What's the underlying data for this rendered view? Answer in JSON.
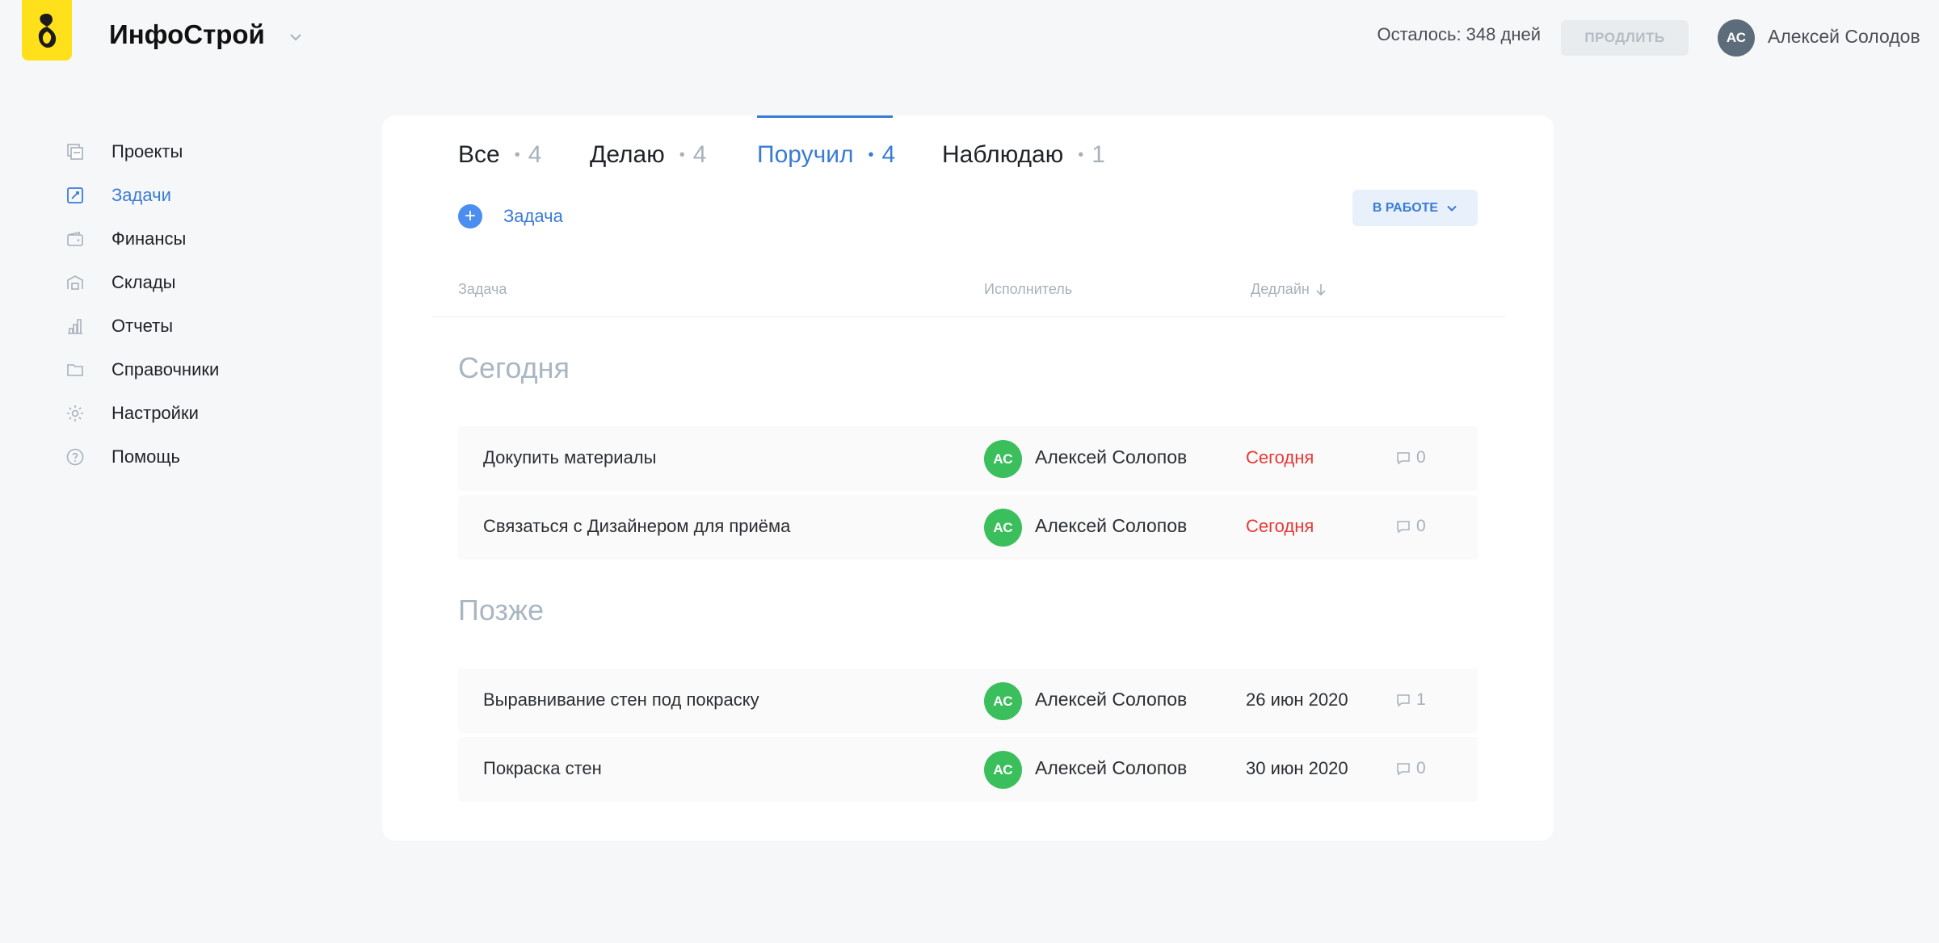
{
  "header": {
    "org_name": "ИнфоСтрой",
    "days_left": "Осталось: 348 дней",
    "extend_label": "ПРОДЛИТЬ",
    "user_initials": "АС",
    "user_name": "Алексей Солодов"
  },
  "sidebar": {
    "items": [
      {
        "label": "Проекты",
        "icon": "projects-icon"
      },
      {
        "label": "Задачи",
        "icon": "tasks-icon",
        "active": true
      },
      {
        "label": "Финансы",
        "icon": "wallet-icon"
      },
      {
        "label": "Склады",
        "icon": "warehouse-icon"
      },
      {
        "label": "Отчеты",
        "icon": "reports-icon"
      },
      {
        "label": "Справочники",
        "icon": "folder-icon"
      },
      {
        "label": "Настройки",
        "icon": "gear-icon"
      },
      {
        "label": "Помощь",
        "icon": "help-icon"
      }
    ]
  },
  "tabs": [
    {
      "label": "Все",
      "count": "4"
    },
    {
      "label": "Делаю",
      "count": "4"
    },
    {
      "label": "Поручил",
      "count": "4",
      "active": true
    },
    {
      "label": "Наблюдаю",
      "count": "1"
    }
  ],
  "toolbar": {
    "add_task_label": "Задача",
    "status_filter": "В РАБОТЕ"
  },
  "table": {
    "columns": {
      "task": "Задача",
      "assignee": "Исполнитель",
      "deadline": "Дедлайн"
    },
    "groups": [
      {
        "title": "Сегодня",
        "rows": [
          {
            "title": "Докупить материалы",
            "initials": "АС",
            "assignee": "Алексей Солопов",
            "deadline": "Сегодня",
            "comments": "0"
          },
          {
            "title": "Связаться с Дизайнером для приёма",
            "initials": "АС",
            "assignee": "Алексей Солопов",
            "deadline": "Сегодня",
            "comments": "0"
          }
        ]
      },
      {
        "title": "Позже",
        "rows": [
          {
            "title": "Выравнивание стен под покраску",
            "initials": "АС",
            "assignee": "Алексей Солопов",
            "deadline": "26 июн 2020",
            "comments": "1"
          },
          {
            "title": "Покраска стен",
            "initials": "АС",
            "assignee": "Алексей Солопов",
            "deadline": "30 июн 2020",
            "comments": "0"
          }
        ]
      }
    ]
  },
  "colors": {
    "accent": "#3a7bd5",
    "logo_yellow": "#ffe01b",
    "avatar_green": "#3bbf5c",
    "overdue_red": "#e53935"
  }
}
